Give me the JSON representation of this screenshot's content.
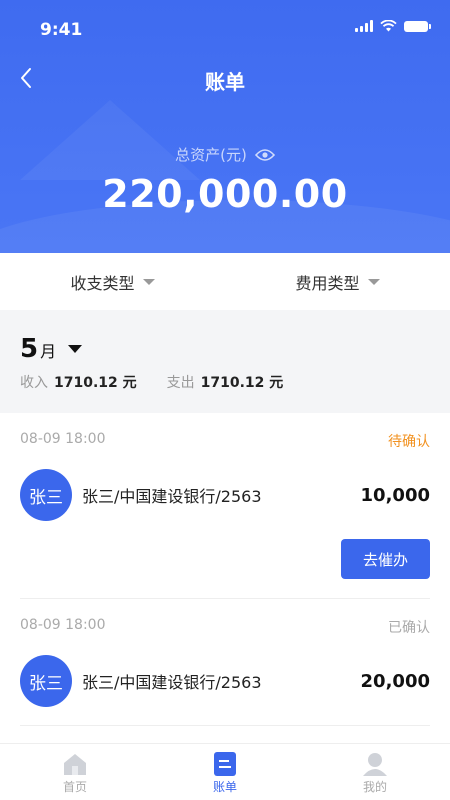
{
  "status_bar": {
    "time": "9:41"
  },
  "nav": {
    "title": "账单"
  },
  "assets": {
    "label": "总资产(元)",
    "amount": "220,000.00"
  },
  "filters": [
    {
      "label": "收支类型"
    },
    {
      "label": "费用类型"
    }
  ],
  "month": {
    "number": "5",
    "unit": "月",
    "income_label": "收入",
    "income_value": "1710.12 元",
    "expense_label": "支出",
    "expense_value": "1710.12 元"
  },
  "records": [
    {
      "time": "08-09 18:00",
      "status": "待确认",
      "avatar": "张三",
      "name": "张三/中国建设银行/2563",
      "amount": "10,000",
      "action": "去催办"
    },
    {
      "time": "08-09 18:00",
      "status": "已确认",
      "avatar": "张三",
      "name": "张三/中国建设银行/2563",
      "amount": "20,000"
    }
  ],
  "tabbar": [
    {
      "label": "首页",
      "icon": "home-icon"
    },
    {
      "label": "账单",
      "icon": "bill-icon"
    },
    {
      "label": "我的",
      "icon": "user-icon"
    }
  ],
  "colors": {
    "primary": "#3b67ec",
    "pending": "#f29221"
  }
}
